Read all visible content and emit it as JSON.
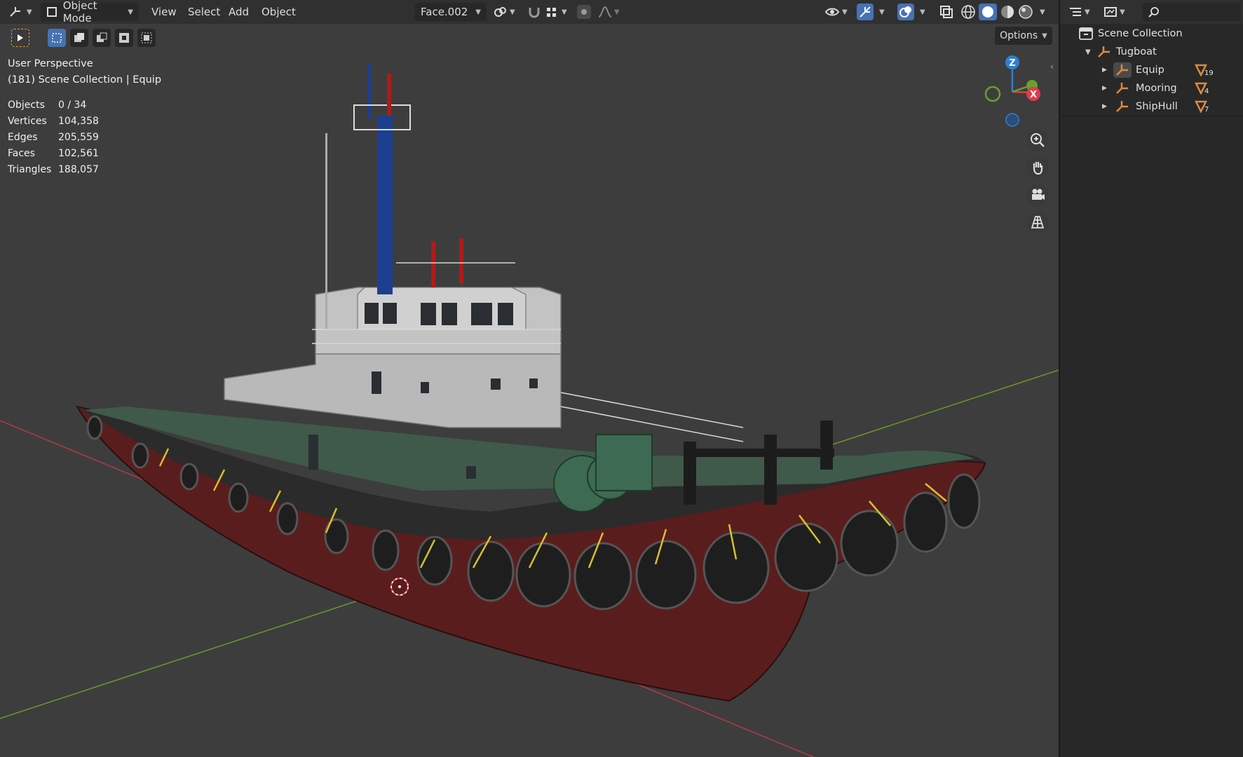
{
  "header": {
    "mode": "Object Mode",
    "menus": [
      "View",
      "Select",
      "Add",
      "Object"
    ],
    "face_set": "Face.002",
    "options_label": "Options"
  },
  "overlay": {
    "view_name": "User Perspective",
    "collection_line": "(181) Scene Collection | Equip",
    "stats": [
      {
        "label": "Objects",
        "value": "0 / 34"
      },
      {
        "label": "Vertices",
        "value": "104,358"
      },
      {
        "label": "Edges",
        "value": "205,559"
      },
      {
        "label": "Faces",
        "value": "102,561"
      },
      {
        "label": "Triangles",
        "value": "188,057"
      }
    ]
  },
  "gizmo": {
    "z": "Z",
    "x": "X"
  },
  "outliner": {
    "root": "Scene Collection",
    "items": [
      {
        "label": "Tugboat"
      },
      {
        "label": "Equip",
        "count": "19"
      },
      {
        "label": "Mooring",
        "count": "4"
      },
      {
        "label": "ShipHull",
        "count": "7"
      }
    ]
  },
  "colors": {
    "accent": "#4772b3",
    "axis_x": "#e03a4c",
    "axis_y": "#6aa02a",
    "axis_z": "#2f7fd1",
    "empty_orange": "#e08a3c"
  }
}
